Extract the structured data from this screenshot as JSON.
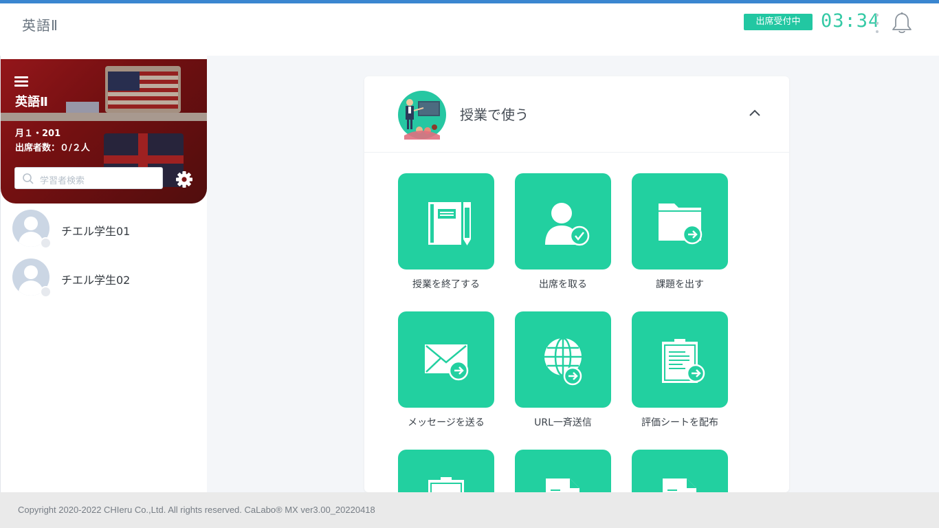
{
  "header": {
    "title": "英語Ⅱ",
    "status_badge": "出席受付中",
    "timer": "03:34"
  },
  "sidebar": {
    "class_name": "英語Ⅱ",
    "period": "月１・201",
    "attendance": "出席者数：０/２人",
    "search_placeholder": "学習者検索",
    "students": [
      {
        "name": "チエル学生01"
      },
      {
        "name": "チエル学生02"
      }
    ]
  },
  "panel": {
    "title": "授業で使う",
    "tiles": [
      {
        "label": "授業を終了する",
        "icon": "notebook-pen-icon"
      },
      {
        "label": "出席を取る",
        "icon": "user-check-icon"
      },
      {
        "label": "課題を出す",
        "icon": "folder-arrow-icon"
      },
      {
        "label": "メッセージを送る",
        "icon": "envelope-arrow-icon"
      },
      {
        "label": "URL一斉送信",
        "icon": "globe-arrow-icon"
      },
      {
        "label": "評価シートを配布",
        "icon": "clipboard-arrow-icon"
      },
      {
        "label": "",
        "icon": "clipboard-icon"
      },
      {
        "label": "",
        "icon": "document-icon"
      },
      {
        "label": "",
        "icon": "document-icon"
      }
    ]
  },
  "footer": {
    "copyright": "Copyright 2020-2022 CHIeru Co.,Ltd. All rights reserved. CaLabo® MX ver3.00_20220418"
  },
  "colors": {
    "accent": "#22d0a0",
    "badge": "#22c7a2",
    "top_stripe": "#3a86d0",
    "timer": "#34c9a5"
  }
}
